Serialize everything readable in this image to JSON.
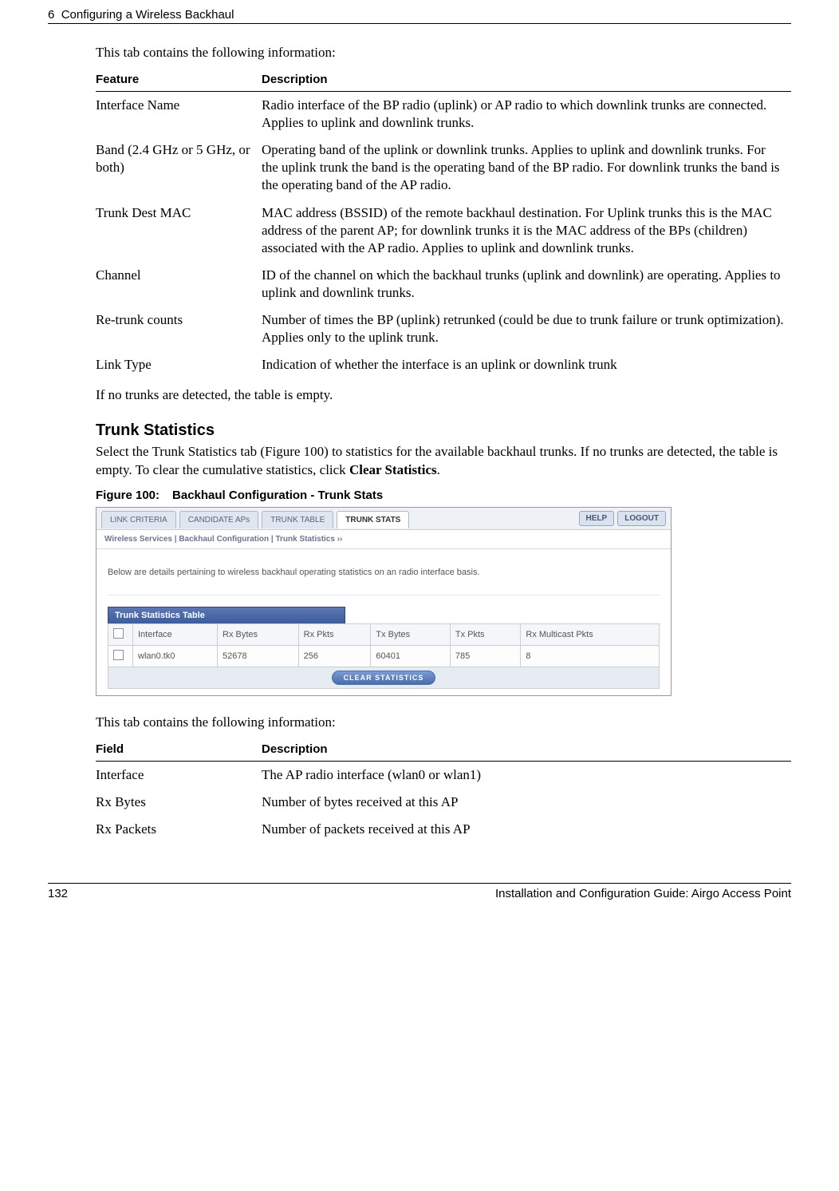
{
  "header": {
    "chapter_num": "6",
    "chapter_title": "Configuring a Wireless Backhaul"
  },
  "intro1": "This tab contains the following information:",
  "table1": {
    "col_feature": "Feature",
    "col_desc": "Description",
    "rows": [
      {
        "feature": "Interface Name",
        "desc": "Radio interface of the BP radio (uplink) or AP radio to which downlink trunks are connected. Applies to uplink and downlink trunks."
      },
      {
        "feature": "Band (2.4 GHz or 5 GHz, or both)",
        "desc": "Operating band of the uplink or downlink trunks. Applies to uplink and downlink trunks. For the uplink trunk the band is the operating band of the BP radio. For downlink trunks the band is the operating band of the AP radio."
      },
      {
        "feature": "Trunk Dest MAC",
        "desc": "MAC address (BSSID) of the remote backhaul destination. For Uplink trunks this is the MAC address of the parent AP; for downlink trunks it is the MAC address of the BPs (children) associated with the AP radio. Applies to uplink and downlink trunks."
      },
      {
        "feature": "Channel",
        "desc": "ID of the channel on which the backhaul trunks (uplink and downlink) are operating. Applies to uplink and downlink trunks."
      },
      {
        "feature": "Re-trunk counts",
        "desc": "Number of times the BP (uplink) retrunked (could be due to trunk failure or trunk optimization). Applies only to the uplink trunk."
      },
      {
        "feature": "Link Type",
        "desc": "Indication of whether the interface is an uplink or downlink trunk"
      }
    ]
  },
  "after_table1": "If no trunks are detected, the table is empty.",
  "section_heading": "Trunk Statistics",
  "section_para_before_bold": "Select the Trunk Statistics tab (Figure 100) to statistics for the available backhaul trunks. If no trunks are detected, the table is empty. To clear the cumulative statistics, click ",
  "section_para_bold": "Clear Statistics",
  "section_para_after_bold": ".",
  "figure": {
    "label": "Figure 100:",
    "title": "Backhaul Configuration - Trunk Stats"
  },
  "screenshot": {
    "tabs": {
      "link_criteria": "LINK CRITERIA",
      "candidate_aps": "CANDIDATE APs",
      "trunk_table": "TRUNK TABLE",
      "trunk_stats": "TRUNK STATS"
    },
    "buttons": {
      "help": "HELP",
      "logout": "LOGOUT"
    },
    "breadcrumb": "Wireless Services | Backhaul Configuration | Trunk Statistics  ››",
    "desc": "Below are details pertaining to wireless backhaul operating statistics on an radio interface basis.",
    "section_bar": "Trunk Statistics Table",
    "cols": {
      "interface": "Interface",
      "rx_bytes": "Rx Bytes",
      "rx_pkts": "Rx Pkts",
      "tx_bytes": "Tx Bytes",
      "tx_pkts": "Tx Pkts",
      "rx_multicast": "Rx Multicast Pkts"
    },
    "row": {
      "interface": "wlan0.tk0",
      "rx_bytes": "52678",
      "rx_pkts": "256",
      "tx_bytes": "60401",
      "tx_pkts": "785",
      "rx_multicast": "8"
    },
    "clear_btn": "CLEAR STATISTICS"
  },
  "intro2": "This tab contains the following information:",
  "table2": {
    "col_field": "Field",
    "col_desc": "Description",
    "rows": [
      {
        "field": "Interface",
        "desc": "The AP radio interface (wlan0 or wlan1)"
      },
      {
        "field": "Rx Bytes",
        "desc": "Number of bytes received at this AP"
      },
      {
        "field": "Rx Packets",
        "desc": "Number of packets received at this AP"
      }
    ]
  },
  "footer": {
    "page": "132",
    "title": "Installation and Configuration Guide: Airgo Access Point"
  }
}
